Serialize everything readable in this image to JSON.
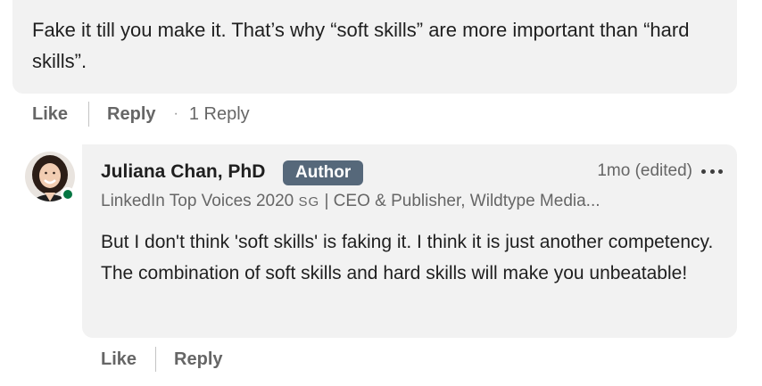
{
  "parent_comment": {
    "text": "Fake it till you make it. That’s why “soft skills” are more important than “hard skills”.",
    "actions": {
      "like_label": "Like",
      "reply_label": "Reply",
      "separator": "·",
      "reply_count": "1 Reply"
    }
  },
  "reply_comment": {
    "author_name": "Juliana Chan, PhD",
    "author_badge": "Author",
    "timestamp": "1mo (edited)",
    "headline_prefix": "LinkedIn Top Voices 2020 ",
    "headline_country": "SG",
    "headline_suffix": " | CEO & Publisher, Wildtype Media...",
    "text": "But I don't think 'soft skills' is faking it. I think it is just another competency. The combination of soft skills and hard skills will make you unbeatable!",
    "presence": "online",
    "actions": {
      "like_label": "Like",
      "reply_label": "Reply"
    }
  },
  "colors": {
    "bubble_bg": "#f2f2f2",
    "badge_bg": "#56687a",
    "presence_green": "#057642",
    "muted_text": "#666666"
  },
  "icons": {
    "more": "more-options-icon",
    "avatar": "profile-photo"
  }
}
